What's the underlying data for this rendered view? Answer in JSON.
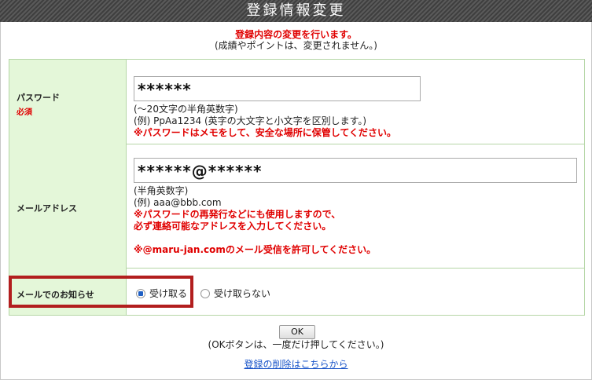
{
  "page_title": "登録情報変更",
  "notice": "登録内容の変更を行います。",
  "sub_notice": "(成績やポイントは、変更されません。)",
  "password": {
    "label": "パスワード",
    "required": "必須",
    "value": "******",
    "note1": "(〜20文字の半角英数字)",
    "note2": "(例) PpAa1234 (英字の大文字と小文字を区別します。)",
    "warning": "※パスワードはメモをして、安全な場所に保管してください。"
  },
  "email": {
    "label": "メールアドレス",
    "value": "******@******",
    "note1": "(半角英数字)",
    "note2": "(例) aaa@bbb.com",
    "warning1": "※パスワードの再発行などにも使用しますので、",
    "warning2": "必ず連絡可能なアドレスを入力してください。",
    "warning3": "※@maru-jan.comのメール受信を許可してください。"
  },
  "mail_notice": {
    "label": "メールでのお知らせ",
    "option_receive": "受け取る",
    "option_not_receive": "受け取らない",
    "selected": "受け取る"
  },
  "ok_button": "OK",
  "ok_note": "(OKボタンは、一度だけ押してください。)",
  "delete_link": "登録の削除はこちらから",
  "colors": {
    "accent_red": "#e00000",
    "label_bg": "#e4f7d9",
    "highlight_border": "#b21e1e",
    "link": "#1a55c9"
  }
}
